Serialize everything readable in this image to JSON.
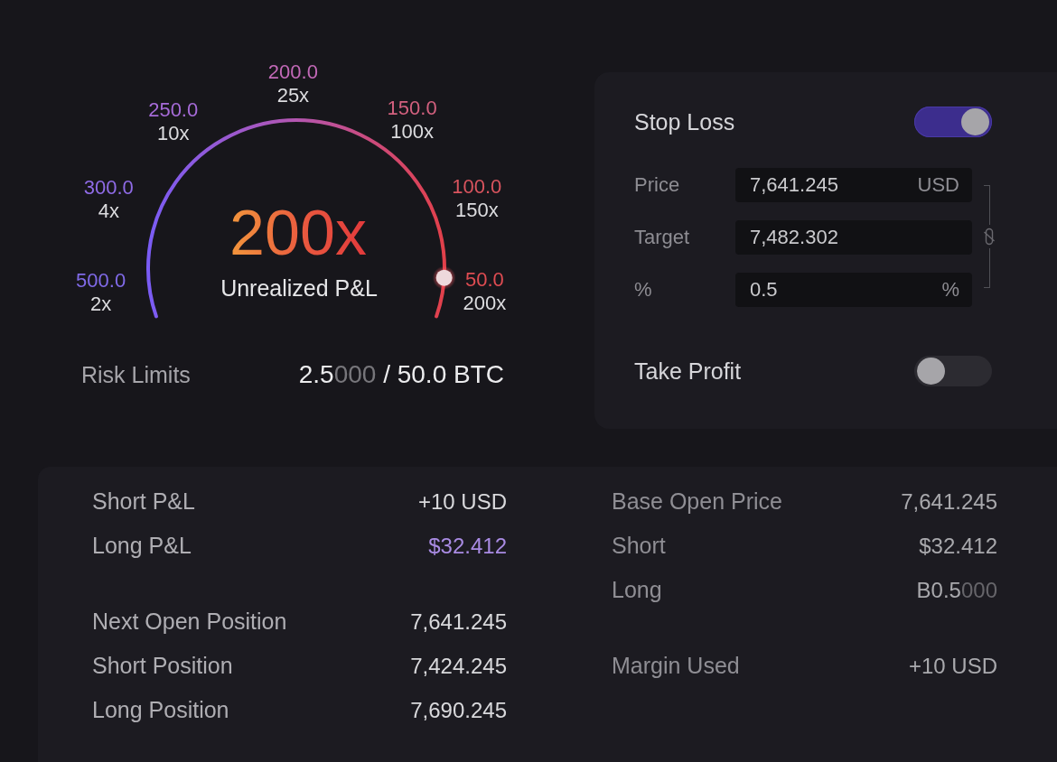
{
  "gauge": {
    "ticks": [
      {
        "price": "500.0",
        "leverage": "2x",
        "color": "#806ae8"
      },
      {
        "price": "300.0",
        "leverage": "4x",
        "color": "#8f6be6"
      },
      {
        "price": "250.0",
        "leverage": "10x",
        "color": "#a66bd8"
      },
      {
        "price": "200.0",
        "leverage": "25x",
        "color": "#c269b7"
      },
      {
        "price": "150.0",
        "leverage": "100x",
        "color": "#d2607e"
      },
      {
        "price": "100.0",
        "leverage": "150x",
        "color": "#d9545e"
      },
      {
        "price": "50.0",
        "leverage": "200x",
        "color": "#df4c52"
      }
    ],
    "readout": "200x",
    "caption": "Unrealized P&L",
    "level": 0.93
  },
  "risk_limits": {
    "label": "Risk Limits",
    "value_parts": [
      {
        "text": "2.5",
        "dim": false
      },
      {
        "text": "000",
        "dim": true
      },
      {
        "text": " / 50.0 BTC",
        "dim": false
      }
    ]
  },
  "stop_loss": {
    "title": "Stop Loss",
    "on": true,
    "fields": [
      {
        "label": "Price",
        "value": "7,641.245",
        "unit": "USD"
      },
      {
        "label": "Target",
        "value": "7,482.302"
      },
      {
        "label": "%",
        "value": "0.5",
        "unit": "%"
      }
    ]
  },
  "take_profit": {
    "title": "Take Profit",
    "on": false
  },
  "summary": {
    "columns": [
      {
        "groups": [
          [
            {
              "label": "Short P&L",
              "value_parts": [
                {
                  "text": "+10 USD",
                  "dim": false
                }
              ],
              "highlighted": false
            },
            {
              "label": "Long P&L",
              "value_parts": [
                {
                  "text": "$32.412",
                  "dim": false
                }
              ],
              "highlighted": true
            }
          ],
          [
            {
              "label": "Next Open Position",
              "value_parts": [
                {
                  "text": "7,641.245",
                  "dim": false
                }
              ],
              "highlighted": false
            },
            {
              "label": "Short Position",
              "value_parts": [
                {
                  "text": "7,424.245",
                  "dim": false
                }
              ],
              "highlighted": false
            },
            {
              "label": "Long Position",
              "value_parts": [
                {
                  "text": "7,690.245",
                  "dim": false
                }
              ],
              "highlighted": false
            }
          ]
        ]
      },
      {
        "groups": [
          [
            {
              "label": "Base Open Price",
              "value_parts": [
                {
                  "text": "7,641.245",
                  "dim": false
                }
              ],
              "highlighted": false
            },
            {
              "label": "Short",
              "value_parts": [
                {
                  "text": "$32.412",
                  "dim": false
                }
              ],
              "highlighted": false
            },
            {
              "label": "Long",
              "value_parts": [
                {
                  "text": "B0.5",
                  "dim": false
                },
                {
                  "text": "000",
                  "dim": true
                }
              ],
              "highlighted": false
            }
          ],
          [
            {
              "label": "Margin Used",
              "value_parts": [
                {
                  "text": "+10 USD",
                  "dim": false
                }
              ],
              "highlighted": false
            }
          ]
        ]
      }
    ]
  }
}
